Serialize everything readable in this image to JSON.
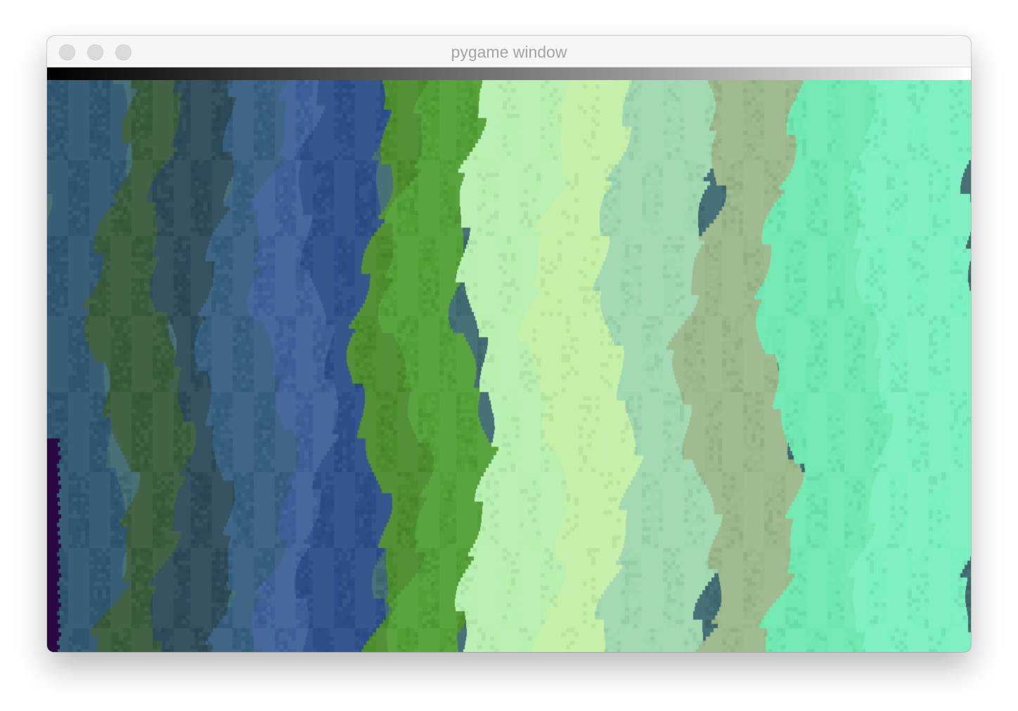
{
  "window": {
    "title": "pygame window"
  },
  "colors": {
    "titlebar": "#f6f6f6",
    "title_text": "#a4a4a4",
    "traffic_light": "#dcdcdc",
    "bands": [
      "#2f5670",
      "#3a5a3c",
      "#2d4a58",
      "#355e80",
      "#3e5f98",
      "#2c4d88",
      "#4b8c2c",
      "#52a035",
      "#b8f0b0",
      "#c4f0a8",
      "#9fd8b0",
      "#9ab88a",
      "#6ee8b0",
      "#7af0c0",
      "#280a40"
    ]
  }
}
